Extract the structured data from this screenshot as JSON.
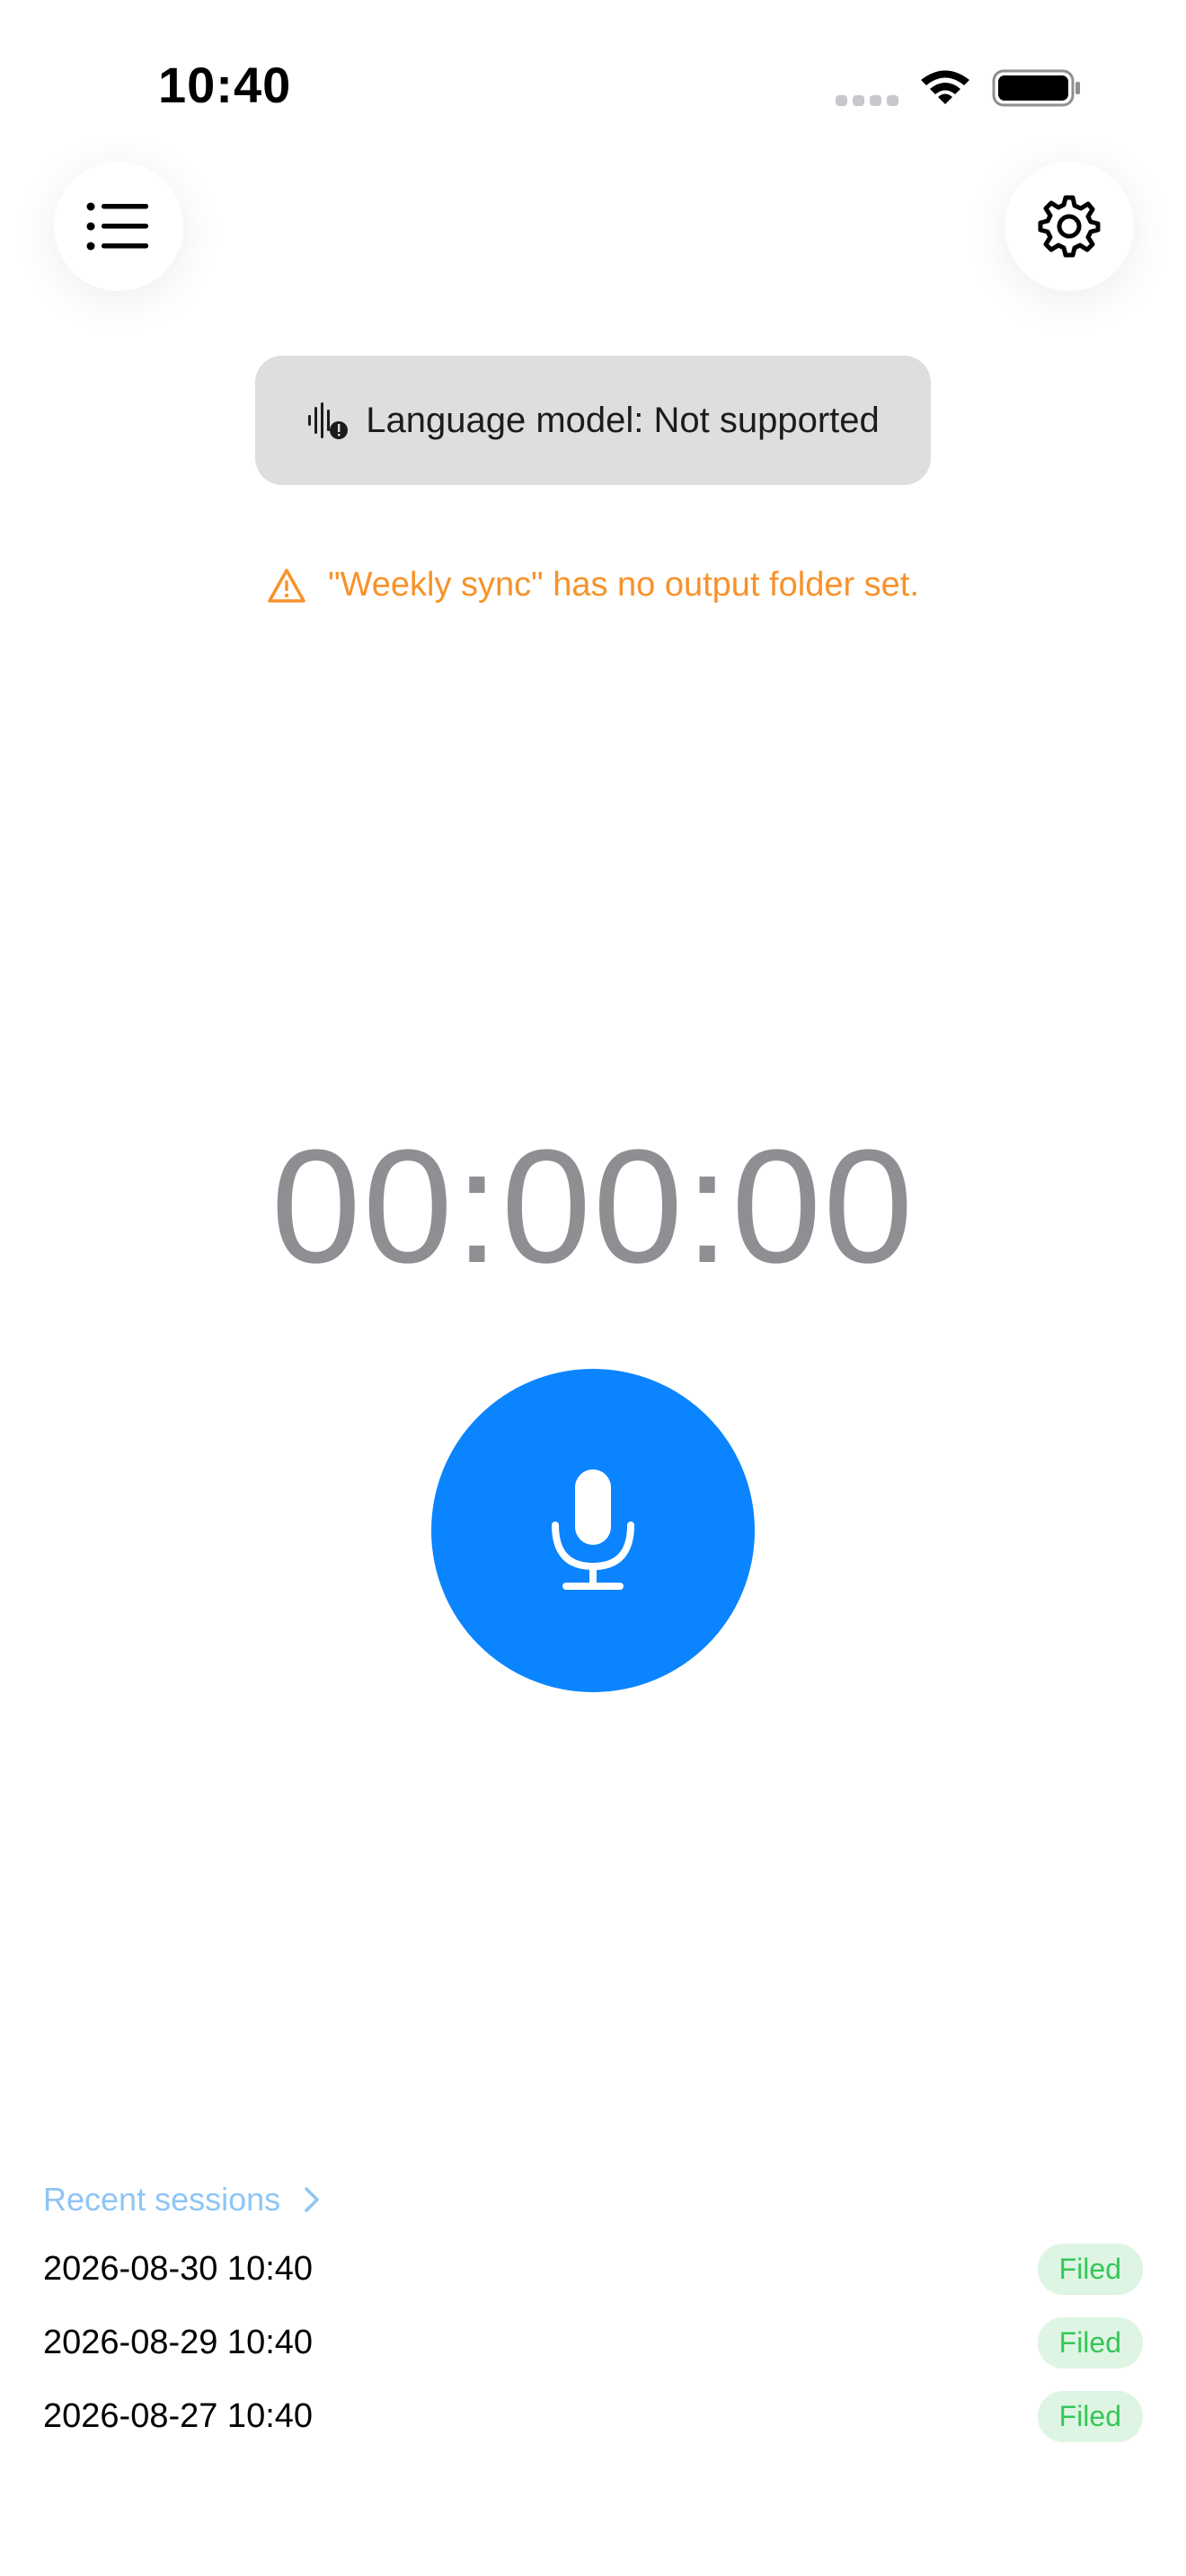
{
  "status_bar": {
    "time": "10:40"
  },
  "language_model": {
    "text": "Language model: Not supported",
    "icon": "waveform-badge-icon"
  },
  "warning": {
    "text": "\"Weekly sync\" has no output folder set.",
    "icon": "warning-triangle-icon",
    "color": "#f7922a"
  },
  "timer": {
    "value": "00:00:00"
  },
  "record": {
    "icon": "microphone-icon",
    "color": "#0a84ff"
  },
  "recent": {
    "label": "Recent sessions",
    "sessions": [
      {
        "date": "2026-08-30 10:40",
        "status": "Filed"
      },
      {
        "date": "2026-08-29 10:40",
        "status": "Filed"
      },
      {
        "date": "2026-08-27 10:40",
        "status": "Filed"
      }
    ]
  }
}
